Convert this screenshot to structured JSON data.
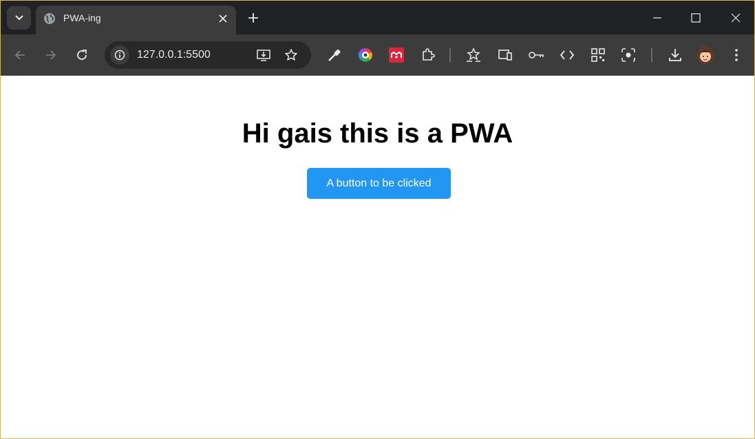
{
  "browser": {
    "tab": {
      "title": "PWA-ing"
    },
    "address_bar": {
      "url": "127.0.0.1:5500"
    }
  },
  "page": {
    "heading": "Hi gais this is a PWA",
    "button_label": "A button to be clicked",
    "accent_color": "#2196f3"
  },
  "icons": [
    "tab-search-icon",
    "globe-icon",
    "close-icon",
    "plus-icon",
    "minimize-icon",
    "maximize-icon",
    "window-close-icon",
    "back-icon",
    "forward-icon",
    "reload-icon",
    "info-icon",
    "install-icon",
    "bookmark-star-icon",
    "eyedropper-icon",
    "color-wheel-icon",
    "mendeley-icon",
    "extensions-icon",
    "reading-list-icon",
    "device-icon",
    "password-key-icon",
    "devtools-icon",
    "qr-code-icon",
    "lens-icon",
    "download-icon",
    "avatar",
    "menu-icon"
  ]
}
